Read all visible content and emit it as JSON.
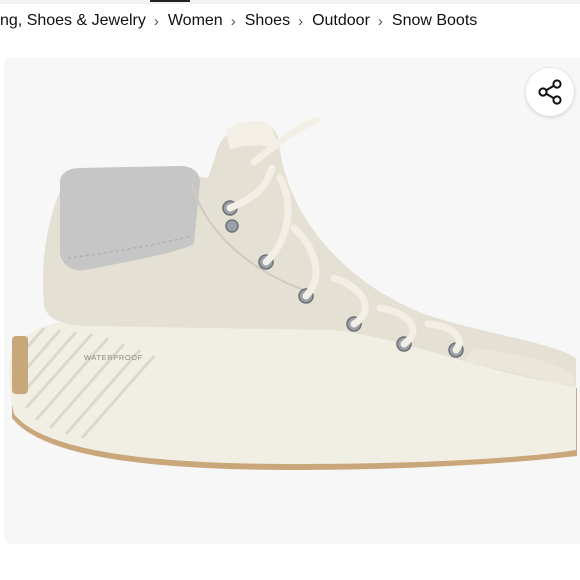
{
  "breadcrumb": {
    "items": [
      {
        "label": "ng, Shoes & Jewelry"
      },
      {
        "label": "Women"
      },
      {
        "label": "Shoes"
      },
      {
        "label": "Outdoor"
      },
      {
        "label": "Snow Boots"
      }
    ],
    "separator": "›"
  },
  "product_image": {
    "subject": "snow-boot",
    "printed_text": "WATERPROOF",
    "colors": {
      "upper": "#e4e0d4",
      "collar": "#c6c6c6",
      "sole": "#f1eee3",
      "outsole": "#c9a77a",
      "laces": "#f4efe6",
      "eyelets": "#9aa0a6"
    }
  },
  "share": {
    "icon": "share-icon"
  }
}
